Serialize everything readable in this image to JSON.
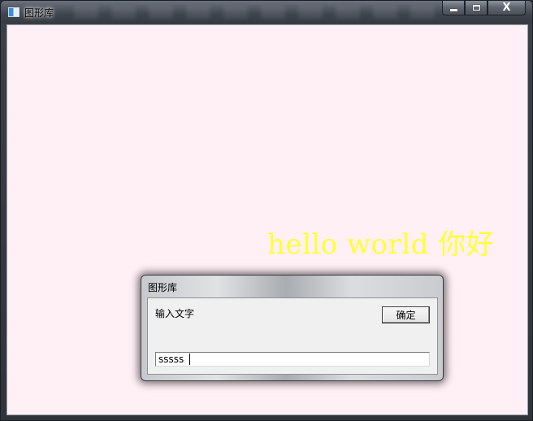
{
  "window": {
    "title": "图形库",
    "close_glyph": "X"
  },
  "canvas": {
    "background": "#fff0f5",
    "text": "hello world 你好",
    "text_color": "#ffff33"
  },
  "dialog": {
    "title": "图形库",
    "prompt": "输入文字",
    "ok_label": "确定",
    "input_value": "sssss"
  },
  "icons": {
    "app": "app-window-icon",
    "minimize": "minimize-icon",
    "maximize": "maximize-icon",
    "close": "close-icon"
  }
}
